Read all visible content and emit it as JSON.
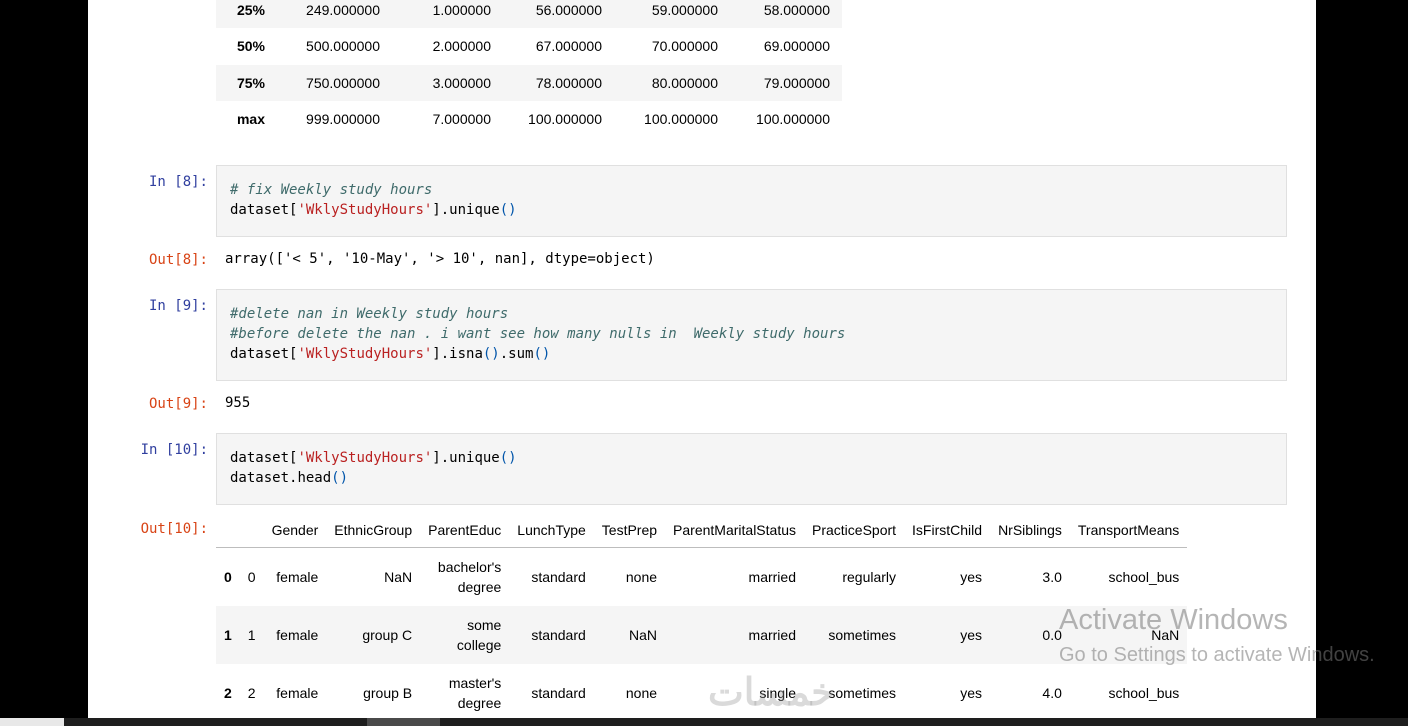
{
  "describe": {
    "rows": [
      {
        "label": "25%",
        "vals": [
          "249.000000",
          "1.000000",
          "56.000000",
          "59.000000",
          "58.000000"
        ]
      },
      {
        "label": "50%",
        "vals": [
          "500.000000",
          "2.000000",
          "67.000000",
          "70.000000",
          "69.000000"
        ]
      },
      {
        "label": "75%",
        "vals": [
          "750.000000",
          "3.000000",
          "78.000000",
          "80.000000",
          "79.000000"
        ]
      },
      {
        "label": "max",
        "vals": [
          "999.000000",
          "7.000000",
          "100.000000",
          "100.000000",
          "100.000000"
        ]
      }
    ]
  },
  "cell8": {
    "prompt_in": "In [8]:",
    "line1": "# fix Weekly study hours",
    "line2_a": "dataset[",
    "line2_s": "'WklyStudyHours'",
    "line2_b": "].unique",
    "line2_p": "()",
    "prompt_out": "Out[8]:",
    "output": "array(['< 5', '10-May', '> 10', nan], dtype=object)"
  },
  "cell9": {
    "prompt_in": "In [9]:",
    "line1": "#delete nan in Weekly study hours",
    "line2": "#before delete the nan . i want see how many nulls in  Weekly study hours",
    "line3_a": "dataset[",
    "line3_s": "'WklyStudyHours'",
    "line3_b": "].isna",
    "line3_p1": "()",
    "line3_c": ".sum",
    "line3_p2": "()",
    "prompt_out": "Out[9]:",
    "output": "955"
  },
  "cell10": {
    "prompt_in": "In [10]:",
    "line1_a": "dataset[",
    "line1_s": "'WklyStudyHours'",
    "line1_b": "].unique",
    "line1_p": "()",
    "line2_a": "dataset",
    "line2_b": ".head",
    "line2_p": "()",
    "prompt_out": "Out[10]:",
    "columns": [
      "",
      "",
      "Gender",
      "EthnicGroup",
      "ParentEduc",
      "LunchType",
      "TestPrep",
      "ParentMaritalStatus",
      "PracticeSport",
      "IsFirstChild",
      "NrSiblings",
      "TransportMeans"
    ],
    "rows": [
      [
        "0",
        "0",
        "female",
        "NaN",
        "bachelor's degree",
        "standard",
        "none",
        "married",
        "regularly",
        "yes",
        "3.0",
        "school_bus"
      ],
      [
        "1",
        "1",
        "female",
        "group C",
        "some college",
        "standard",
        "NaN",
        "married",
        "sometimes",
        "yes",
        "0.0",
        "NaN"
      ],
      [
        "2",
        "2",
        "female",
        "group B",
        "master's degree",
        "standard",
        "none",
        "single",
        "sometimes",
        "yes",
        "4.0",
        "school_bus"
      ]
    ]
  },
  "watermark": {
    "title": "Activate Windows",
    "subtitle": "Go to Settings to activate Windows.",
    "logo": "خمسات"
  }
}
